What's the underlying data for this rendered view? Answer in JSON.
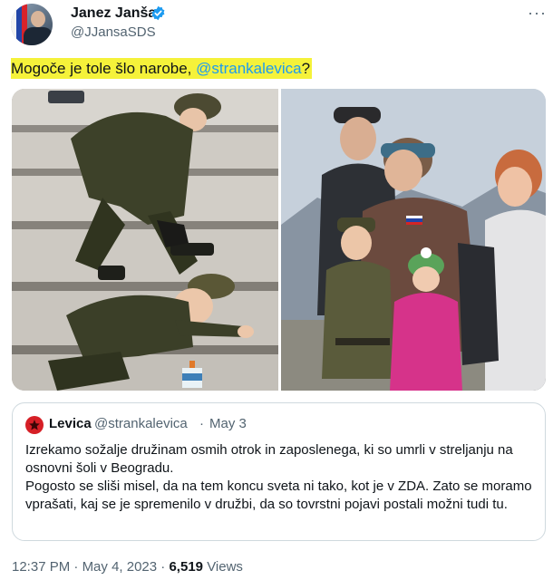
{
  "author": {
    "name": "Janez Janša",
    "handle": "@JJansaSDS",
    "verified": true
  },
  "tweet": {
    "text_prefix": "Mogoče je tole šlo narobe, ",
    "mention": "@strankalevica",
    "text_suffix": "?",
    "highlight_color": "#f5f23a"
  },
  "quoted": {
    "name": "Levica",
    "handle": "@strankalevica",
    "separator": "·",
    "date": "May 3",
    "paragraph1": "Izrekamo sožalje družinam osmih otrok in zaposlenega, ki so umrli v streljanju na osnovni šoli v Beogradu.",
    "paragraph2": "Pogosto se sliši misel, da na tem koncu sveta ni tako, kot je v ZDA. Zato se moramo vprašati, kaj se je spremenilo v družbi, da so tovrstni pojavi postali možni tudi tu."
  },
  "footer": {
    "time": "12:37 PM",
    "separator": "·",
    "date": "May 4, 2023",
    "views_count": "6,519",
    "views_label": "Views"
  },
  "colors": {
    "link": "#1d9bf0",
    "secondary_text": "#536471",
    "levica_red": "#d61f26"
  }
}
